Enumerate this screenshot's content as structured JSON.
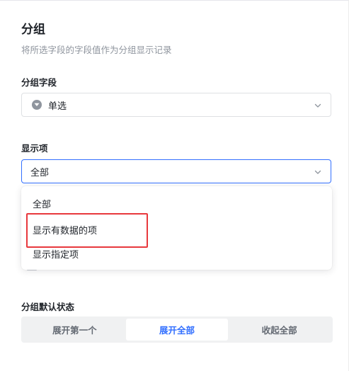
{
  "panel": {
    "title": "分组",
    "description": "将所选字段的字段值作为分组显示记录"
  },
  "group_field": {
    "label": "分组字段",
    "value": "单选",
    "icon": "single-select-field-icon"
  },
  "display_items": {
    "label": "显示项",
    "value": "全部",
    "options": [
      "全部",
      "显示有数据的项",
      "显示指定项"
    ]
  },
  "default_state": {
    "label": "分组默认状态",
    "options": [
      "展开第一个",
      "展开全部",
      "收起全部"
    ],
    "selected": "展开全部"
  },
  "colors": {
    "accent": "#3370ff",
    "highlight": "#e8383d"
  }
}
